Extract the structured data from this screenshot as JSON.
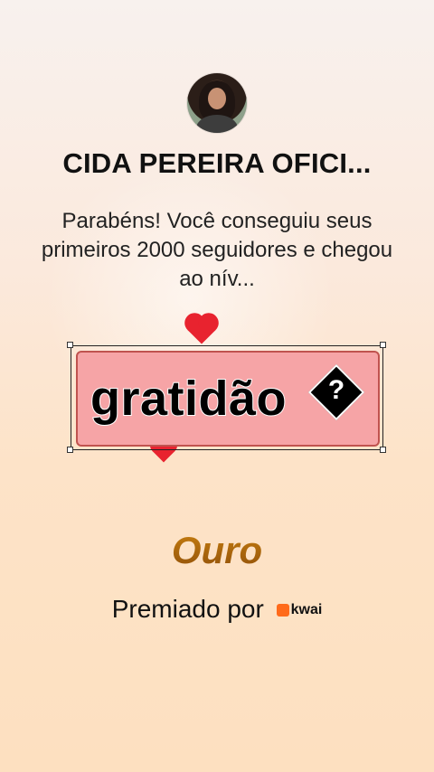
{
  "profile": {
    "name": "CIDA PEREIRA OFICI...",
    "avatar_icon": "profile-photo-avatar"
  },
  "message": {
    "text": "Parabéns! Você conseguiu seus primeiros 2000 seguidores e chegou ao nív..."
  },
  "sticker": {
    "text": "gratidão",
    "glyph": "?"
  },
  "level": {
    "label": "Ouro"
  },
  "award": {
    "prefix": "Premiado por",
    "brand": "kwai",
    "brand_color": "#ff6a1a"
  },
  "colors": {
    "sticker_bg": "#f6a4a6",
    "heart": "#e8232f",
    "level_gold": "#b86a10"
  }
}
